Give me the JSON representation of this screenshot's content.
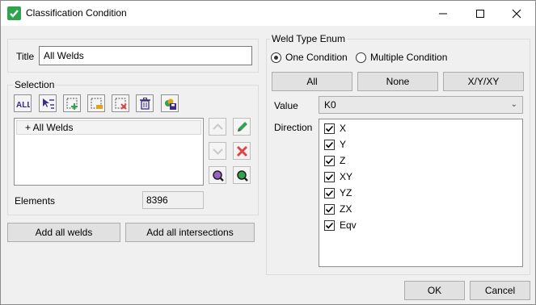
{
  "window": {
    "title": "Classification Condition",
    "icon": "checkmark-app-icon",
    "controls": [
      "minimize-icon",
      "maximize-icon",
      "close-icon"
    ]
  },
  "left": {
    "title_label": "Title",
    "title_value": "All Welds",
    "selection_label": "Selection",
    "toolbar_icons": [
      "select-all-icon",
      "select-list-icon",
      "add-selection-icon",
      "replace-selection-icon",
      "remove-selection-icon",
      "delete-icon",
      "save-selection-icon"
    ],
    "selection_items": [
      "+ All Welds"
    ],
    "side_icons": [
      "move-up-icon",
      "edit-pencil-icon",
      "move-down-icon",
      "remove-x-icon",
      "zoom-purple-icon",
      "zoom-green-icon"
    ],
    "elements_label": "Elements",
    "elements_value": "8396",
    "add_all_welds": "Add all welds",
    "add_all_intersections": "Add all intersections"
  },
  "right": {
    "weld_type_label": "Weld Type Enum",
    "radio_one": "One Condition",
    "radio_multiple": "Multiple Condition",
    "radio_selected": "One Condition",
    "btn_all": "All",
    "btn_none": "None",
    "btn_xyz": "X/Y/XY",
    "value_label": "Value",
    "value_selected": "K0",
    "direction_label": "Direction",
    "directions": [
      {
        "label": "X",
        "checked": true
      },
      {
        "label": "Y",
        "checked": true
      },
      {
        "label": "Z",
        "checked": true
      },
      {
        "label": "XY",
        "checked": true
      },
      {
        "label": "YZ",
        "checked": true
      },
      {
        "label": "ZX",
        "checked": true
      },
      {
        "label": "Eqv",
        "checked": true
      }
    ]
  },
  "footer": {
    "ok": "OK",
    "cancel": "Cancel"
  },
  "colors": {
    "accent_green": "#2ea44f",
    "delete_red": "#e04545",
    "dialog_bg": "#f0f0f0"
  }
}
